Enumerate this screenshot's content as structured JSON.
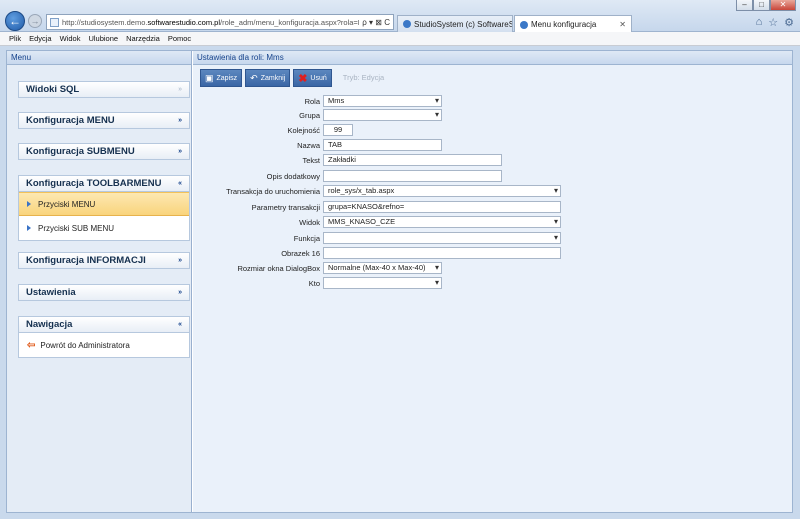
{
  "browser": {
    "url_prefix": "http://studiosystem.demo.",
    "url_domain": "softwarestudio.com.pl",
    "url_suffix": "/role_adm/menu_konfiguracja.aspx?rola=M",
    "addr_tools": "ρ ▾ ⊠ C",
    "tabs": [
      {
        "label": "StudioSystem (c) SoftwareStud...",
        "active": false
      },
      {
        "label": "Menu konfiguracja",
        "active": true
      }
    ],
    "menu": [
      "Plik",
      "Edycja",
      "Widok",
      "Ulubione",
      "Narzędzia",
      "Pomoc"
    ]
  },
  "sidebar": {
    "title": "Menu",
    "groups": [
      {
        "label": "Widoki SQL",
        "chevron": "»"
      },
      {
        "label": "Konfiguracja MENU",
        "chevron": "»"
      },
      {
        "label": "Konfiguracja SUBMENU",
        "chevron": "»"
      },
      {
        "label": "Konfiguracja TOOLBARMENU",
        "chevron": "«",
        "items": [
          "Przyciski MENU",
          "Przyciski SUB MENU"
        ]
      },
      {
        "label": "Konfiguracja INFORMACJI",
        "chevron": "»"
      },
      {
        "label": "Ustawienia",
        "chevron": "»"
      },
      {
        "label": "Nawigacja",
        "chevron": "«",
        "items": [
          "Powrót do Administratora"
        ]
      }
    ]
  },
  "main": {
    "title": "Ustawienia dla roli: Mms",
    "toolbar": {
      "save": "Zapisz",
      "close": "Zamknij",
      "delete": "Usuń",
      "disabled": "Tryb: Edycja"
    },
    "form": {
      "rola": {
        "label": "Rola",
        "value": "Mms"
      },
      "grupa": {
        "label": "Grupa",
        "value": ""
      },
      "kolejnosc": {
        "label": "Kolejność",
        "value": "99"
      },
      "nazwa": {
        "label": "Nazwa",
        "value": "TAB"
      },
      "tekst": {
        "label": "Tekst",
        "value": "Zakładki"
      },
      "opis": {
        "label": "Opis dodatkowy",
        "value": ""
      },
      "transakcja": {
        "label": "Transakcja do uruchomienia",
        "value": "role_sys/x_tab.aspx"
      },
      "parametry": {
        "label": "Parametry transakcji",
        "value": "grupa=KNASO&refno="
      },
      "widok": {
        "label": "Widok",
        "value": "MMS_KNASO_CZE"
      },
      "funkcja": {
        "label": "Funkcja",
        "value": ""
      },
      "obrazek": {
        "label": "Obrazek 16",
        "value": ""
      },
      "rozmiar": {
        "label": "Rozmiar okna DialogBox",
        "value": "Normalne (Max-40 x Max-40)"
      },
      "kto": {
        "label": "Kto",
        "value": ""
      }
    }
  }
}
